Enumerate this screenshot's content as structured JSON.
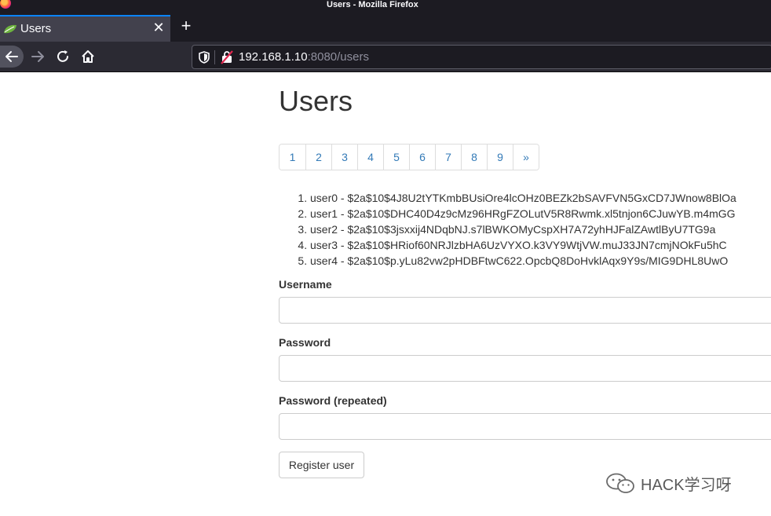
{
  "window": {
    "title": "Users - Mozilla Firefox"
  },
  "tab": {
    "label": "Users",
    "close_glyph": "✕"
  },
  "new_tab_glyph": "+",
  "url": {
    "host": "192.168.1.10",
    "rest": ":8080/users"
  },
  "page": {
    "title": "Users",
    "pagination": [
      "1",
      "2",
      "3",
      "4",
      "5",
      "6",
      "7",
      "8",
      "9",
      "»"
    ],
    "users": [
      "user0 - $2a$10$4J8U2tYTKmbBUsiOre4lcOHz0BEZk2bSAVFVN5GxCD7JWnow8BlOa",
      "user1 - $2a$10$DHC40D4z9cMz96HRgFZOLutV5R8Rwmk.xl5tnjon6CJuwYB.m4mGG",
      "user2 - $2a$10$3jsxxij4NDqbNJ.s7lBWKOMyCspXH7A72yhHJFalZAwtlByU7TG9a",
      "user3 - $2a$10$HRiof60NRJlzbHA6UzVYXO.k3VY9WtjVW.muJ33JN7cmjNOkFu5hC",
      "user4 - $2a$10$p.yLu82vw2pHDBFtwC622.OpcbQ8DoHvklAqx9Y9s/MIG9DHL8UwO"
    ],
    "form": {
      "username_label": "Username",
      "password_label": "Password",
      "password_repeat_label": "Password (repeated)",
      "username_value": "",
      "password_value": "",
      "password_repeat_value": "",
      "submit_label": "Register user"
    }
  },
  "watermark": {
    "text": "HACK学习呀"
  },
  "colors": {
    "link": "#337ab7",
    "tab_accent": "#0a84ff",
    "chrome_dark": "#1c1b22"
  }
}
